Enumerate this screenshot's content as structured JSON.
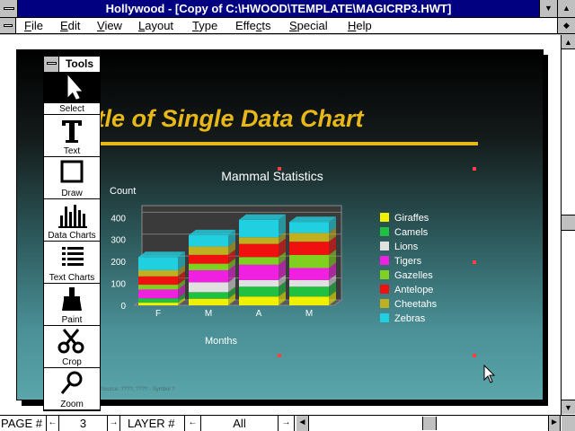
{
  "window": {
    "title": "Hollywood - [Copy of C:\\HWOOD\\TEMPLATE\\MAGICRP3.HWT]",
    "minimize_glyph": "▼",
    "maximize_glyph": "▲",
    "restore_glyph": "◆"
  },
  "menu": [
    {
      "label": "File",
      "accel": "F",
      "rest": "ile"
    },
    {
      "label": "Edit",
      "accel": "E",
      "rest": "dit"
    },
    {
      "label": "View",
      "accel": "V",
      "rest": "iew"
    },
    {
      "label": "Layout",
      "accel": "L",
      "rest": "ayout"
    },
    {
      "label": "Type",
      "accel": "T",
      "rest": "ype"
    },
    {
      "label": "Effects",
      "accel": "c",
      "pre": "Effe",
      "rest": "ts"
    },
    {
      "label": "Special",
      "accel": "S",
      "rest": "pecial"
    },
    {
      "label": "Help",
      "accel": "H",
      "rest": "elp"
    }
  ],
  "tools": {
    "title": "Tools",
    "items": [
      {
        "name": "select",
        "label": "Select"
      },
      {
        "name": "text",
        "label": "Text"
      },
      {
        "name": "draw",
        "label": "Draw"
      },
      {
        "name": "data-charts",
        "label": "Data Charts"
      },
      {
        "name": "text-charts",
        "label": "Text Charts"
      },
      {
        "name": "paint",
        "label": "Paint"
      },
      {
        "name": "crop",
        "label": "Crop"
      },
      {
        "name": "zoom",
        "label": "Zoom"
      }
    ]
  },
  "slide": {
    "title": "itle of Single Data Chart",
    "footnote": "Source: ????, ???? - Symbol ?",
    "title_color": "#e8b818"
  },
  "chart_data": {
    "type": "bar",
    "stacked": true,
    "title": "Mammal Statistics",
    "ylabel": "Count",
    "xlabel": "Months",
    "categories": [
      "F",
      "M",
      "A",
      "M"
    ],
    "yticks": [
      0,
      100,
      200,
      300,
      400
    ],
    "ylim": [
      0,
      430
    ],
    "legend_position": "right",
    "series": [
      {
        "name": "Giraffes",
        "color": "#f0f000",
        "values": [
          12,
          30,
          40,
          40
        ]
      },
      {
        "name": "Camels",
        "color": "#20c040",
        "values": [
          20,
          30,
          45,
          45
        ]
      },
      {
        "name": "Lions",
        "color": "#e0e0e0",
        "values": [
          0,
          45,
          30,
          30
        ]
      },
      {
        "name": "Tigers",
        "color": "#f020e0",
        "values": [
          40,
          55,
          70,
          55
        ]
      },
      {
        "name": "Gazelles",
        "color": "#80d020",
        "values": [
          22,
          30,
          35,
          60
        ]
      },
      {
        "name": "Antelope",
        "color": "#f01010",
        "values": [
          38,
          40,
          60,
          60
        ]
      },
      {
        "name": "Cheetahs",
        "color": "#c0b020",
        "values": [
          28,
          38,
          30,
          40
        ]
      },
      {
        "name": "Zebras",
        "color": "#20d0e0",
        "values": [
          60,
          52,
          80,
          50
        ]
      }
    ]
  },
  "status": {
    "page_label": "PAGE #",
    "page_value": "3",
    "layer_label": "LAYER #",
    "layer_value": "All",
    "left_arrow": "←",
    "right_arrow": "→",
    "scroll_left": "◄",
    "scroll_right": "►",
    "scroll_up": "▲",
    "scroll_down": "▼"
  }
}
